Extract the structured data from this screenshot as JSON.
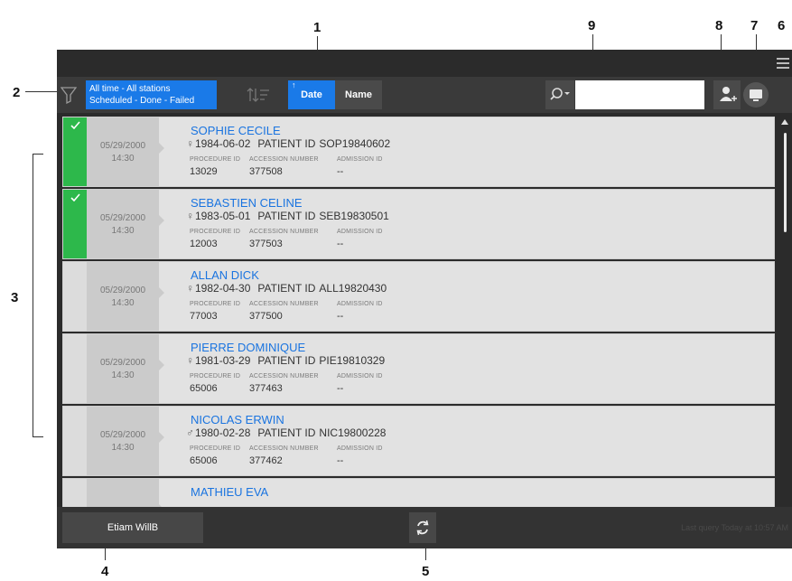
{
  "callouts": [
    "1",
    "2",
    "3",
    "4",
    "5",
    "6",
    "7",
    "8",
    "9"
  ],
  "toolbar": {
    "filter_line1": "All time - All stations",
    "filter_line2": "Scheduled - Done - Failed",
    "sort_date_label": "Date",
    "sort_name_label": "Name",
    "search_value": "",
    "search_placeholder": ""
  },
  "colors": {
    "accent": "#1a7ae8",
    "done_status": "#2db84b",
    "name_link": "#1a74e0"
  },
  "icons": [
    "menu-icon",
    "filter-icon",
    "sort-icon",
    "search-icon",
    "add-patient-icon",
    "monitor-icon",
    "check-icon",
    "refresh-icon",
    "female-icon",
    "male-icon"
  ],
  "list": {
    "headers": {
      "procedure": "PROCEDURE ID",
      "accession": "ACCESSION NUMBER",
      "admission": "ADMISSION ID",
      "patient_id_label": "PATIENT ID"
    },
    "rows": [
      {
        "status": "done",
        "date": "05/29/2000",
        "time": "14:30",
        "name": "SOPHIE CECILE",
        "sex": "♀",
        "birth": "1984-06-02",
        "patient_id": "SOP19840602",
        "procedure_id": "13029",
        "accession": "377508",
        "admission": "--"
      },
      {
        "status": "done",
        "date": "05/29/2000",
        "time": "14:30",
        "name": "SEBASTIEN CELINE",
        "sex": "♀",
        "birth": "1983-05-01",
        "patient_id": "SEB19830501",
        "procedure_id": "12003",
        "accession": "377503",
        "admission": "--"
      },
      {
        "status": "scheduled",
        "date": "05/29/2000",
        "time": "14:30",
        "name": "ALLAN DICK",
        "sex": "♀",
        "birth": "1982-04-30",
        "patient_id": "ALL19820430",
        "procedure_id": "77003",
        "accession": "377500",
        "admission": "--"
      },
      {
        "status": "scheduled",
        "date": "05/29/2000",
        "time": "14:30",
        "name": "PIERRE DOMINIQUE",
        "sex": "♀",
        "birth": "1981-03-29",
        "patient_id": "PIE19810329",
        "procedure_id": "65006",
        "accession": "377463",
        "admission": "--"
      },
      {
        "status": "scheduled",
        "date": "05/29/2000",
        "time": "14:30",
        "name": "NICOLAS ERWIN",
        "sex": "♂",
        "birth": "1980-02-28",
        "patient_id": "NIC19800228",
        "procedure_id": "65006",
        "accession": "377462",
        "admission": "--"
      },
      {
        "status": "scheduled",
        "date": "",
        "time": "",
        "name": "MATHIEU EVA",
        "sex": "",
        "birth": "",
        "patient_id": "",
        "procedure_id": "",
        "accession": "",
        "admission": ""
      }
    ]
  },
  "bottom": {
    "user_label": "Etiam WillB",
    "last_query": "Last query Today at 10:57 AM"
  }
}
